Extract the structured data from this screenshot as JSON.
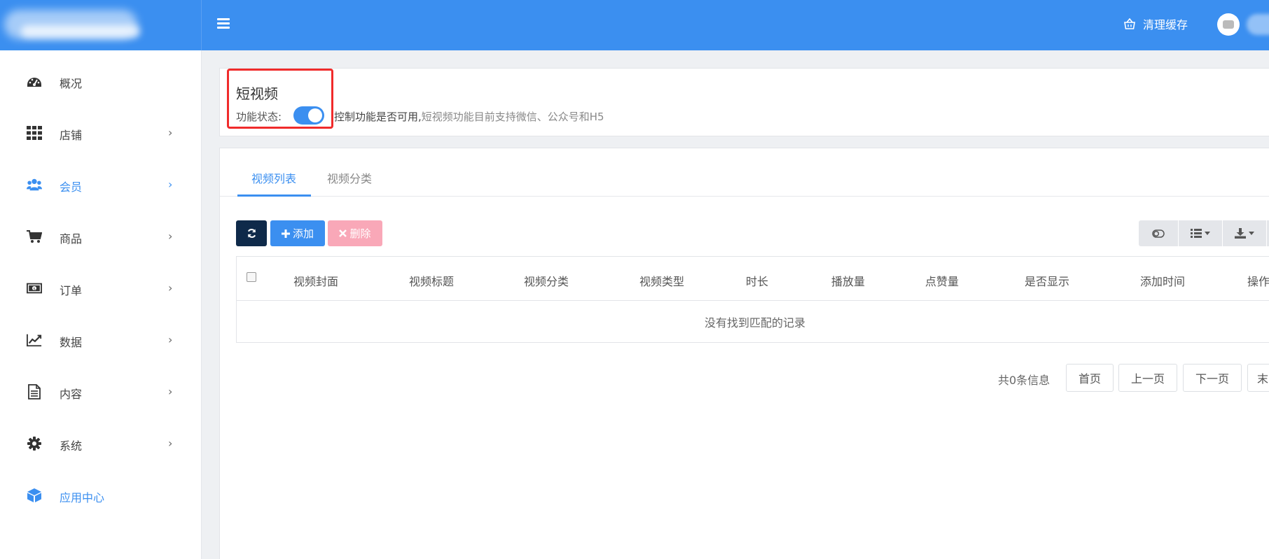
{
  "header": {
    "clear_cache_label": "清理缓存",
    "clear_cache_icon": "basket-icon",
    "menu_icon": "hamburger-icon",
    "brand_color": "#3b8ff0"
  },
  "sidebar": {
    "items": [
      {
        "label": "概况",
        "icon": "dashboard-icon",
        "has_submenu": false,
        "active": false
      },
      {
        "label": "店铺",
        "icon": "grid-icon",
        "has_submenu": true,
        "active": false
      },
      {
        "label": "会员",
        "icon": "users-icon",
        "has_submenu": true,
        "active": true
      },
      {
        "label": "商品",
        "icon": "cart-icon",
        "has_submenu": true,
        "active": false
      },
      {
        "label": "订单",
        "icon": "money-icon",
        "has_submenu": true,
        "active": false
      },
      {
        "label": "数据",
        "icon": "line-chart-icon",
        "has_submenu": true,
        "active": false
      },
      {
        "label": "内容",
        "icon": "document-icon",
        "has_submenu": true,
        "active": false
      },
      {
        "label": "系统",
        "icon": "gear-icon",
        "has_submenu": true,
        "active": false
      },
      {
        "label": "应用中心",
        "icon": "cube-icon",
        "has_submenu": false,
        "active": true
      }
    ],
    "chevron": "›"
  },
  "status_panel": {
    "title": "短视频",
    "status_label": "功能状态:",
    "toggle_on": true,
    "desc_main": "控制功能是否可用,",
    "desc_sub": "短视频功能目前支持微信、公众号和H5"
  },
  "tabs": [
    {
      "label": "视频列表",
      "active": true
    },
    {
      "label": "视频分类",
      "active": false
    }
  ],
  "toolbar": {
    "refresh_icon": "refresh-icon",
    "add_label": "添加",
    "add_icon": "plus-icon",
    "delete_label": "删除",
    "delete_icon": "x-icon",
    "right_tools": [
      "toggle-view-icon",
      "columns-icon",
      "export-icon"
    ]
  },
  "table": {
    "columns": [
      "视频封面",
      "视频标题",
      "视频分类",
      "视频类型",
      "时长",
      "播放量",
      "点赞量",
      "是否显示",
      "添加时间",
      "操作"
    ],
    "empty_text": "没有找到匹配的记录"
  },
  "pagination": {
    "info": "共0条信息",
    "first": "首页",
    "prev": "上一页",
    "next": "下一页",
    "last": "末页"
  }
}
